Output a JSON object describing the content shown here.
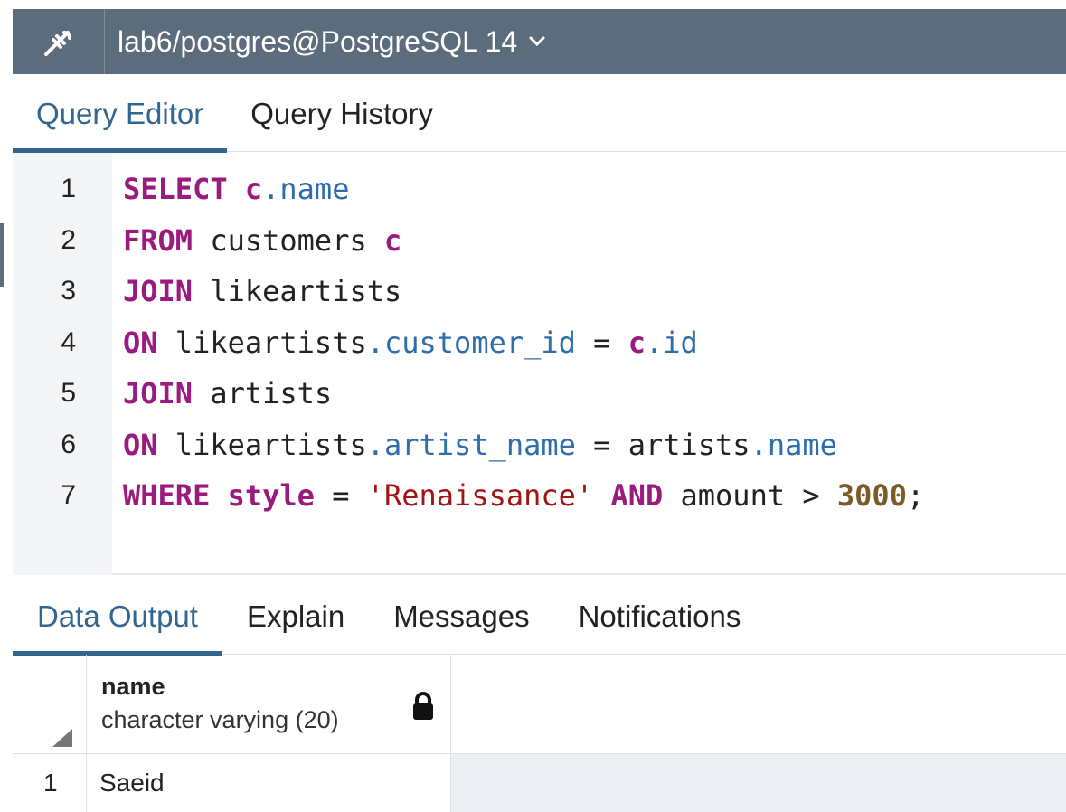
{
  "connection": {
    "title": "lab6/postgres@PostgreSQL 14",
    "icon": "connection-plug-icon",
    "dropdown_icon": "chevron-down-icon"
  },
  "editor_tabs": [
    {
      "label": "Query Editor",
      "active": true
    },
    {
      "label": "Query History",
      "active": false
    }
  ],
  "editor": {
    "line_numbers": [
      "1",
      "2",
      "3",
      "4",
      "5",
      "6",
      "7"
    ],
    "tokens": {
      "select": "SELECT",
      "c": "c",
      "dot": ".",
      "name": "name",
      "from": "FROM",
      "customers": " customers ",
      "join": "JOIN",
      "likeartists": " likeartists",
      "on": "ON",
      "likeartists_ref": " likeartists",
      "customer_id": "customer_id",
      "eq": " = ",
      "id": "id",
      "artists": " artists",
      "artist_name": "artist_name",
      "artists_ref": "artists",
      "where": "WHERE",
      "style": "style",
      "renaissance": "'Renaissance'",
      "and": "AND",
      "amount": " amount > ",
      "num": "3000",
      "semi": ";"
    }
  },
  "output_tabs": [
    {
      "label": "Data Output",
      "active": true
    },
    {
      "label": "Explain",
      "active": false
    },
    {
      "label": "Messages",
      "active": false
    },
    {
      "label": "Notifications",
      "active": false
    }
  ],
  "grid": {
    "columns": [
      {
        "name": "name",
        "type": "character varying (20)",
        "icon": "lock-icon"
      }
    ],
    "rows": [
      {
        "num": "1",
        "cells": [
          "Saeid"
        ]
      }
    ]
  },
  "colors": {
    "header_bg": "#5b6d7c",
    "accent": "#326690",
    "keyword": "#9b1a80",
    "property": "#2f6eab",
    "string": "#a31515",
    "number": "#7a5c28"
  }
}
